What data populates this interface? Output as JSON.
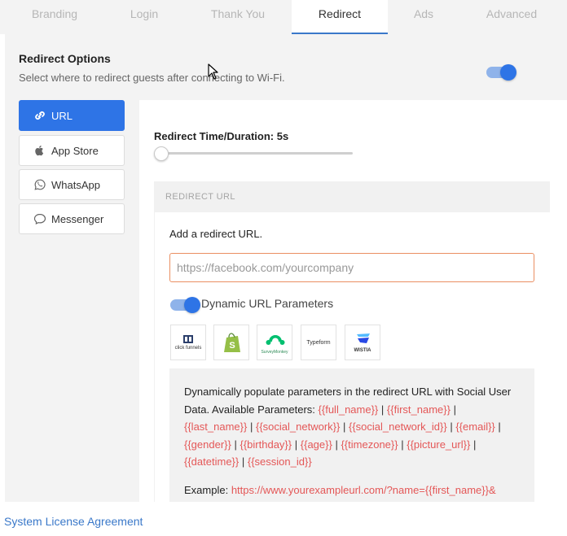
{
  "tabs": [
    {
      "label": "Branding"
    },
    {
      "label": "Login"
    },
    {
      "label": "Thank You"
    },
    {
      "label": "Redirect"
    },
    {
      "label": "Ads"
    },
    {
      "label": "Advanced"
    }
  ],
  "active_tab": "Redirect",
  "redirect_options": {
    "title": "Redirect Options",
    "subtitle": "Select where to redirect guests after connecting to Wi-Fi.",
    "enabled": true
  },
  "sidebar": {
    "items": [
      {
        "label": "URL",
        "icon": "link-icon",
        "active": true
      },
      {
        "label": "App Store",
        "icon": "apple-icon",
        "active": false
      },
      {
        "label": "WhatsApp",
        "icon": "whatsapp-icon",
        "active": false
      },
      {
        "label": "Messenger",
        "icon": "messenger-icon",
        "active": false
      }
    ]
  },
  "duration": {
    "label": "Redirect Time/Duration: 5s",
    "value_seconds": 5
  },
  "redirect_url": {
    "section_header": "REDIRECT URL",
    "add_label": "Add a redirect URL.",
    "input_value": "",
    "input_placeholder": "https://facebook.com/yourcompany",
    "dynamic_params_label": "Dynamic URL Parameters",
    "dynamic_params_enabled": true
  },
  "integrations": [
    {
      "name": "ClickFunnels",
      "label": "click funnels"
    },
    {
      "name": "Shopify",
      "label": ""
    },
    {
      "name": "SurveyMonkey",
      "label": "SurveyMonkey"
    },
    {
      "name": "Typeform",
      "label": "Typeform"
    },
    {
      "name": "Wistia",
      "label": "WISTIA"
    }
  ],
  "info": {
    "intro": "Dynamically populate parameters in the redirect URL with Social User Data. Available Parameters:",
    "params": [
      "{{full_name}}",
      "{{first_name}}",
      "{{last_name}}",
      "{{social_network}}",
      "{{social_network_id}}",
      "{{email}}",
      "{{gender}}",
      "{{birthday}}",
      "{{age}}",
      "{{timezone}}",
      "{{picture_url}}",
      "{{datetime}}",
      "{{session_id}}"
    ],
    "example_label": "Example:",
    "example_url": "https://www.yourexampleurl.com/?name={{first_name}}&"
  },
  "footer": {
    "link": "System License Agreement"
  },
  "colors": {
    "accent": "#2e74e6",
    "param_red": "#e45757",
    "input_border": "#ea8f62",
    "link_blue": "#3a78c9"
  }
}
